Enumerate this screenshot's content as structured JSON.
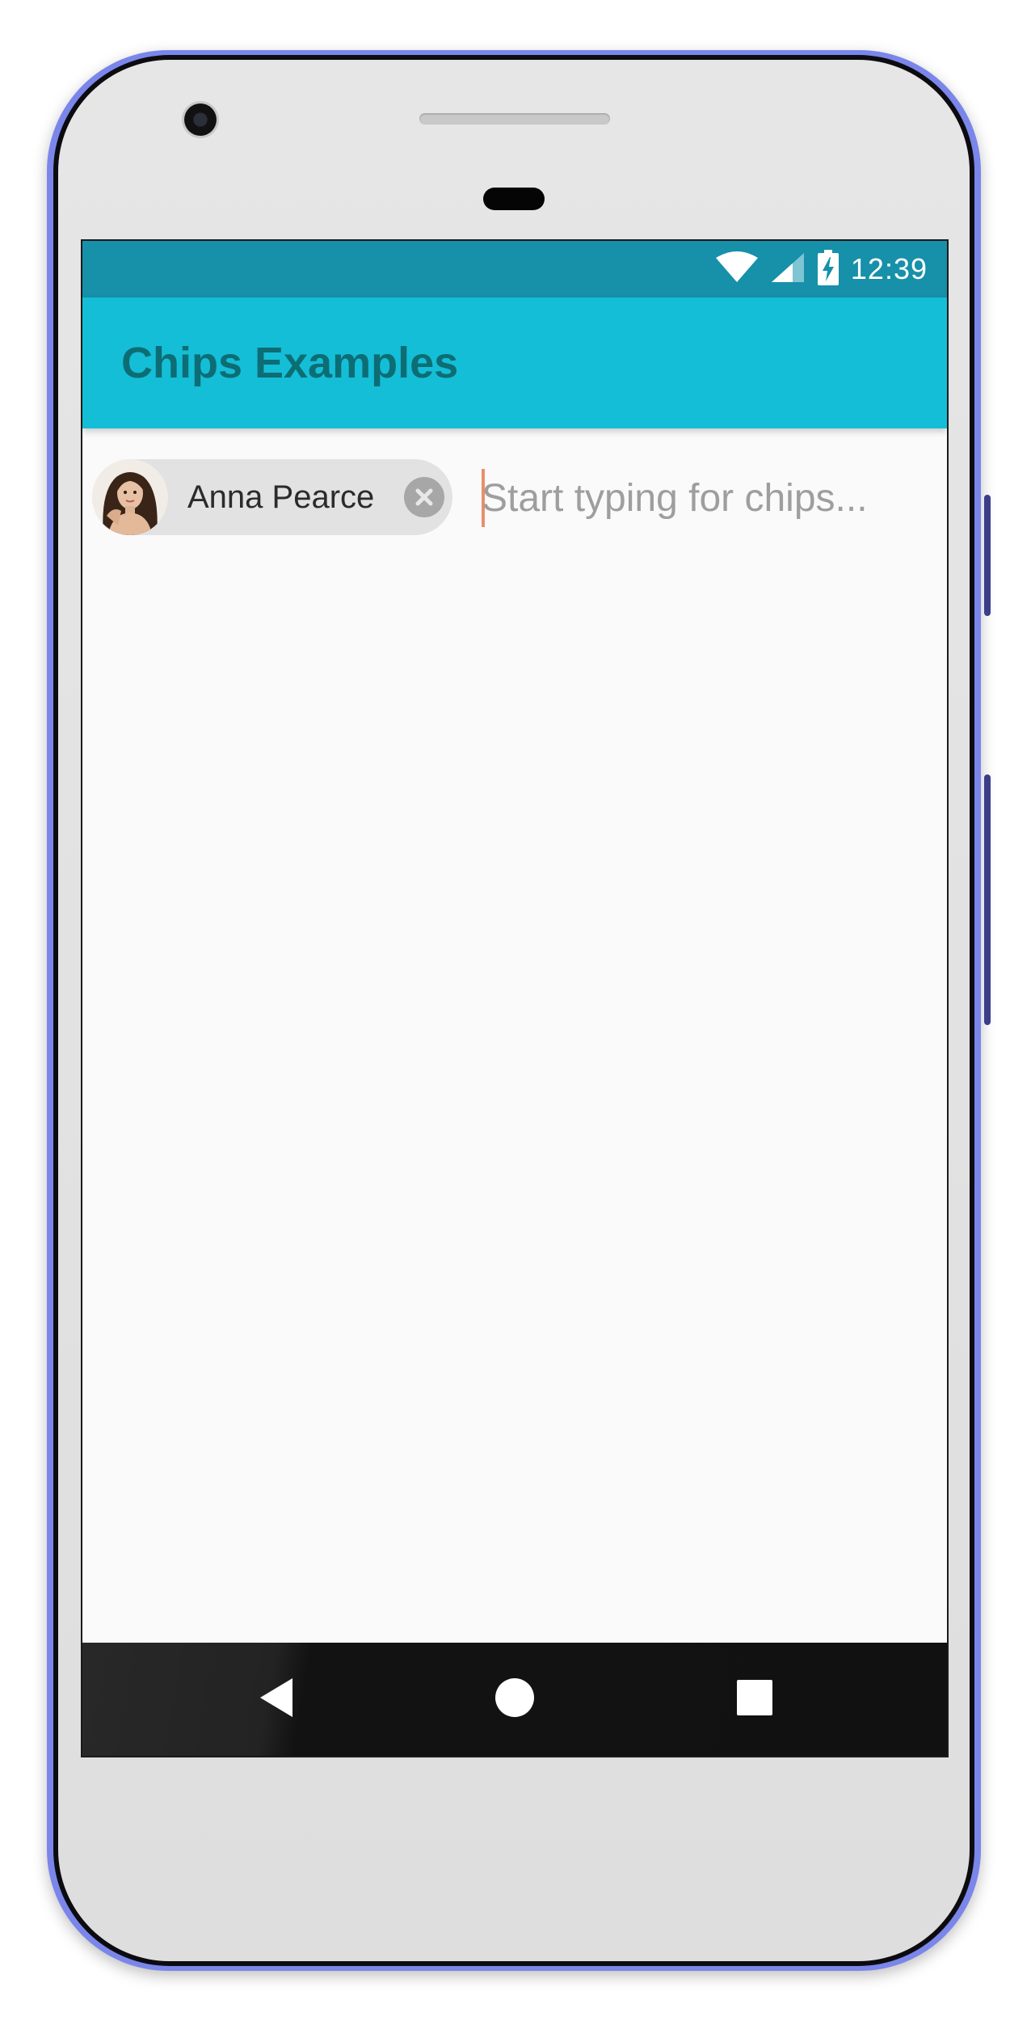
{
  "status_bar": {
    "time": "12:39",
    "icons": [
      "wifi-icon",
      "cell-signal-icon",
      "battery-charging-icon"
    ]
  },
  "app_bar": {
    "title": "Chips Examples"
  },
  "chip": {
    "label": "Anna Pearce",
    "avatar_icon": "avatar-photo",
    "close_icon": "close-icon"
  },
  "chips_input": {
    "value": "",
    "placeholder": "Start typing for chips..."
  },
  "nav_bar": {
    "icons": [
      "back-icon",
      "home-icon",
      "recents-icon"
    ]
  },
  "colors": {
    "status_bar": "#1790a9",
    "app_bar": "#14bed7",
    "title_text": "#0d6d74",
    "chip_bg": "#e2e2e2",
    "cursor": "#e8906a",
    "nav_bar": "#111111"
  }
}
